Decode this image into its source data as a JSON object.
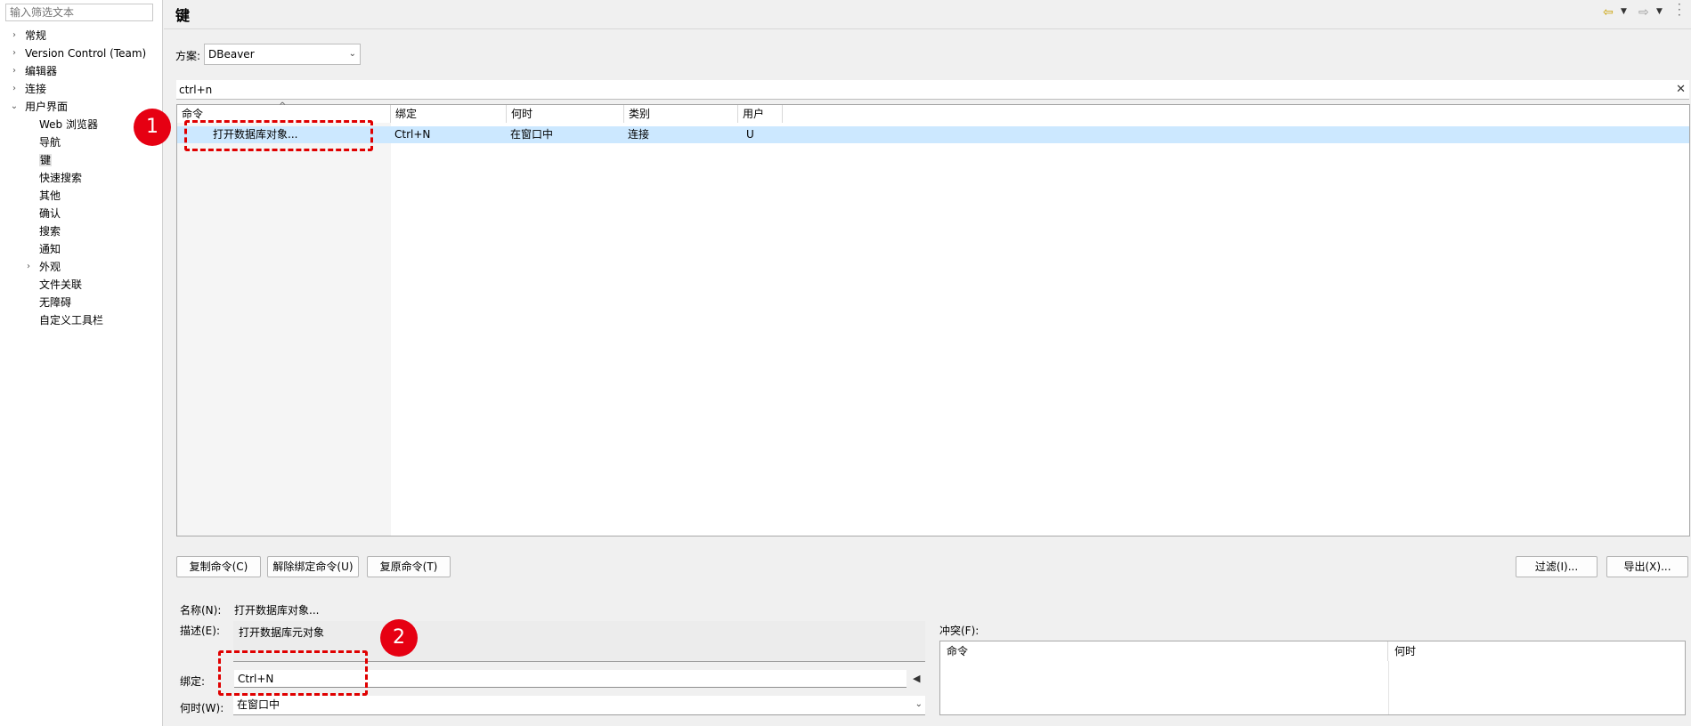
{
  "sidebar": {
    "filter_placeholder": "输入筛选文本",
    "items": [
      {
        "label": "常规",
        "expander": "›"
      },
      {
        "label": "Version Control (Team)",
        "expander": "›"
      },
      {
        "label": "编辑器",
        "expander": "›"
      },
      {
        "label": "连接",
        "expander": "›"
      },
      {
        "label": "用户界面",
        "expander": "⌄"
      },
      {
        "label": "Web 浏览器"
      },
      {
        "label": "导航"
      },
      {
        "label": "键"
      },
      {
        "label": "快速搜索"
      },
      {
        "label": "其他"
      },
      {
        "label": "确认"
      },
      {
        "label": "搜索"
      },
      {
        "label": "通知"
      },
      {
        "label": "外观",
        "expander": "›"
      },
      {
        "label": "文件关联"
      },
      {
        "label": "无障碍"
      },
      {
        "label": "自定义工具栏"
      }
    ]
  },
  "page": {
    "title": "键"
  },
  "scheme": {
    "label": "方案:",
    "value": "DBeaver"
  },
  "search": {
    "value": "ctrl+n",
    "clear_glyph": "✕"
  },
  "table": {
    "sort_glyph": "^",
    "columns": [
      "命令",
      "绑定",
      "何时",
      "类别",
      "用户"
    ],
    "rows": [
      {
        "command": "打开数据库对象...",
        "binding": "Ctrl+N",
        "when": "在窗口中",
        "category": "连接",
        "user": "U"
      }
    ]
  },
  "buttons": {
    "copy": "复制命令(C)",
    "unbind": "解除绑定命令(U)",
    "restore": "复原命令(T)",
    "filter": "过滤(I)...",
    "export": "导出(X)..."
  },
  "details": {
    "name_label": "名称(N):",
    "name_value": "打开数据库对象...",
    "desc_label": "描述(E):",
    "desc_value": "打开数据库元对象",
    "binding_label": "绑定:",
    "binding_value": "Ctrl+N",
    "when_label": "何时(W):",
    "when_value": "在窗口中",
    "conflict_label": "冲突(F):",
    "conflict_columns": [
      "命令",
      "何时"
    ]
  },
  "annotations": {
    "badge1": "1",
    "badge2": "2"
  },
  "colors": {
    "selected_row": "#cce8ff",
    "annotation_red": "#e60012"
  }
}
